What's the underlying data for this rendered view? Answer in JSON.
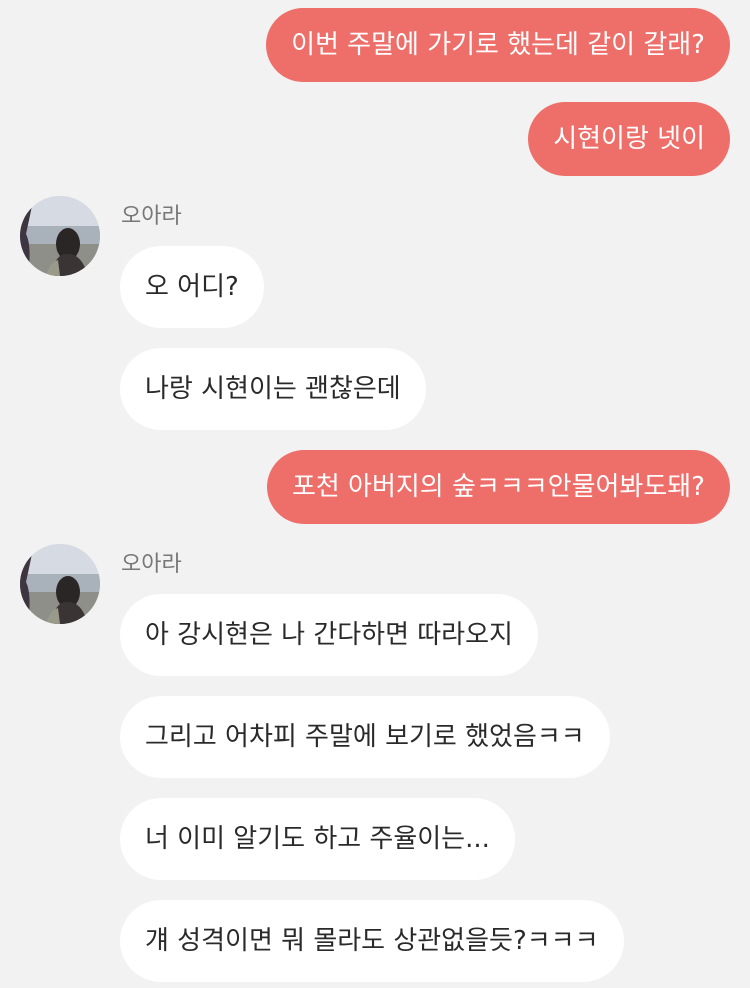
{
  "colors": {
    "background": "#f2f2f2",
    "outgoing_bubble": "#ee6f6a",
    "incoming_bubble": "#ffffff"
  },
  "messages": {
    "m1": "이번 주말에 가기로 했는데 같이 갈래?",
    "m2": "시현이랑 넷이",
    "m3": "오 어디?",
    "m4": "나랑 시현이는 괜찮은데",
    "m5": "포천 아버지의 숲ㅋㅋㅋ안물어봐도돼?",
    "m6": "아 강시현은 나 간다하면 따라오지",
    "m7": "그리고 어차피 주말에  보기로 했었음ㅋㅋ",
    "m8": "너 이미 알기도 하고 주율이는...",
    "m9": "걔 성격이면 뭐 몰라도 상관없을듯?ㅋㅋㅋ"
  },
  "senders": {
    "group1": "오아라",
    "group2": "오아라"
  },
  "icons": {
    "avatar": "profile-photo-woman-at-beach"
  }
}
